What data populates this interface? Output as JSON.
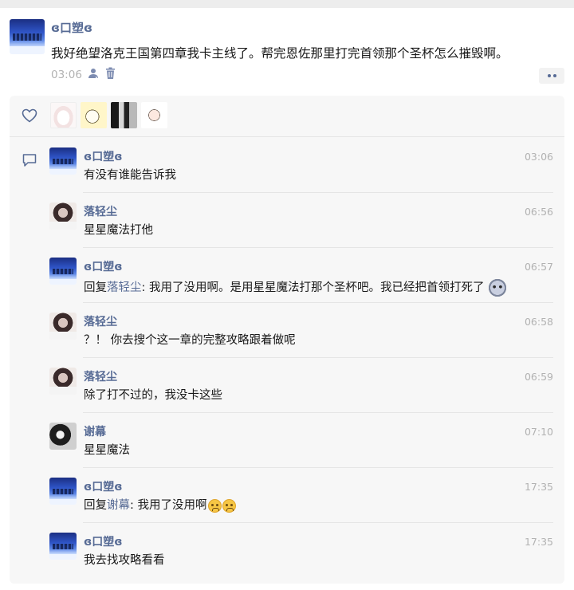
{
  "post": {
    "author": "ɞ口塑ɞ",
    "text": "我好绝望洛克王国第四章我卡主线了。帮完恩佐那里打完首领那个圣杯怎么摧毁啊。",
    "time": "03:06",
    "icons": [
      "user-icon",
      "trash-icon",
      "more-icon"
    ]
  },
  "likes": {
    "icon": "heart-icon",
    "likers": [
      "liker-1",
      "liker-2",
      "liker-3",
      "liker-4"
    ]
  },
  "comments": [
    {
      "author": "ɞ口塑ɞ",
      "text": "有没有谁能告诉我",
      "time": "03:06"
    },
    {
      "author": "落轻尘",
      "text": "星星魔法打他",
      "time": "06:56"
    },
    {
      "author": "ɞ口塑ɞ",
      "reply_prefix": "回复",
      "reply_to": "落轻尘",
      "text": ": 我用了没用啊。是用星星魔法打那个圣杯吧。我已经把首领打死了",
      "time": "06:57"
    },
    {
      "author": "落轻尘",
      "text": "？！ 你去搜个这一章的完整攻略跟着做呢",
      "time": "06:58"
    },
    {
      "author": "落轻尘",
      "text": "除了打不过的，我没卡这些",
      "time": "06:59"
    },
    {
      "author": "谢幕",
      "text": "星星魔法",
      "time": "07:10"
    },
    {
      "author": "ɞ口塑ɞ",
      "reply_prefix": "回复",
      "reply_to": "谢幕",
      "text": ": 我用了没用啊",
      "time": "17:35"
    },
    {
      "author": "ɞ口塑ɞ",
      "text": "我去找攻略看看",
      "time": "17:35"
    }
  ]
}
